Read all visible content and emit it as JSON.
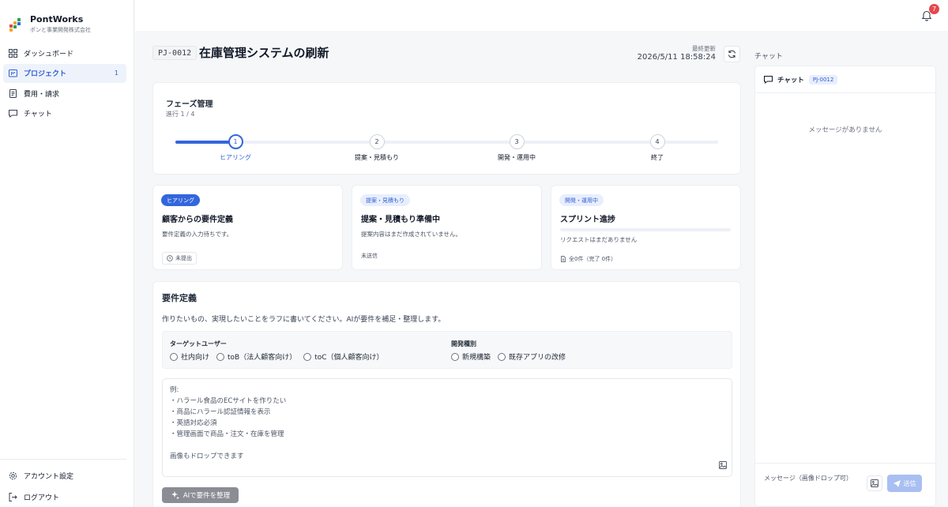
{
  "brand": {
    "name": "PontWorks",
    "company": "ポンと事業開発株式会社"
  },
  "nav": {
    "items": [
      {
        "label": "ダッシュボード",
        "icon": "dashboard-icon"
      },
      {
        "label": "プロジェクト",
        "icon": "project-icon",
        "badge": "1",
        "active": true
      },
      {
        "label": "費用・請求",
        "icon": "receipt-icon"
      },
      {
        "label": "チャット",
        "icon": "chat-icon"
      }
    ],
    "bottom": [
      {
        "label": "アカウント設定",
        "icon": "gear-icon"
      },
      {
        "label": "ログアウト",
        "icon": "logout-icon"
      }
    ]
  },
  "notifications": {
    "count": "7"
  },
  "project": {
    "code": "PJ-0012",
    "title": "在庫管理システムの刷新",
    "updated_label": "最終更新",
    "updated_value": "2026/5/11 18:58:24"
  },
  "phase": {
    "title": "フェーズ管理",
    "progress_text": "進行 1 / 4",
    "progress": 0.11,
    "steps": [
      {
        "num": "1",
        "label": "ヒアリング",
        "active": true
      },
      {
        "num": "2",
        "label": "提案・見積もり"
      },
      {
        "num": "3",
        "label": "開発・運用中"
      },
      {
        "num": "4",
        "label": "終了"
      }
    ]
  },
  "phase_cards": [
    {
      "tag": "ヒアリング",
      "title": "顧客からの要件定義",
      "desc": "要件定義の入力待ちです。",
      "status": "未提出"
    },
    {
      "tag": "提案・見積もり",
      "title": "提案・見積もり準備中",
      "desc": "提案内容はまだ作成されていません。",
      "status": "未送信"
    },
    {
      "tag": "開発・運用中",
      "title": "スプリント進捗",
      "desc": "リクエストはまだありません",
      "status": "全0件（完了 0件）",
      "progress": 0
    }
  ],
  "requirements": {
    "title": "要件定義",
    "intro": "作りたいもの、実現したいことをラフに書いてください。AIが要件を補足・整理します。",
    "target_label": "ターゲットユーザー",
    "target_options": [
      "社内向け",
      "toB（法人顧客向け）",
      "toC（個人顧客向け）"
    ],
    "dev_label": "開発種別",
    "dev_options": [
      "新規構築",
      "既存アプリの改修"
    ],
    "placeholder_lines": [
      "例:",
      "・ハラール食品のECサイトを作りたい",
      "・商品にハラール認証情報を表示",
      "・英語対応必須",
      "・管理画面で商品・注文・在庫を管理",
      "画像もドロップできます"
    ],
    "ai_button": "AIで要件を整理"
  },
  "chat": {
    "section_label": "チャット",
    "title": "チャット",
    "tag": "PJ-0012",
    "empty": "メッセージがありません",
    "input_placeholder": "メッセージ（画像ドロップ可）",
    "send": "送信"
  }
}
